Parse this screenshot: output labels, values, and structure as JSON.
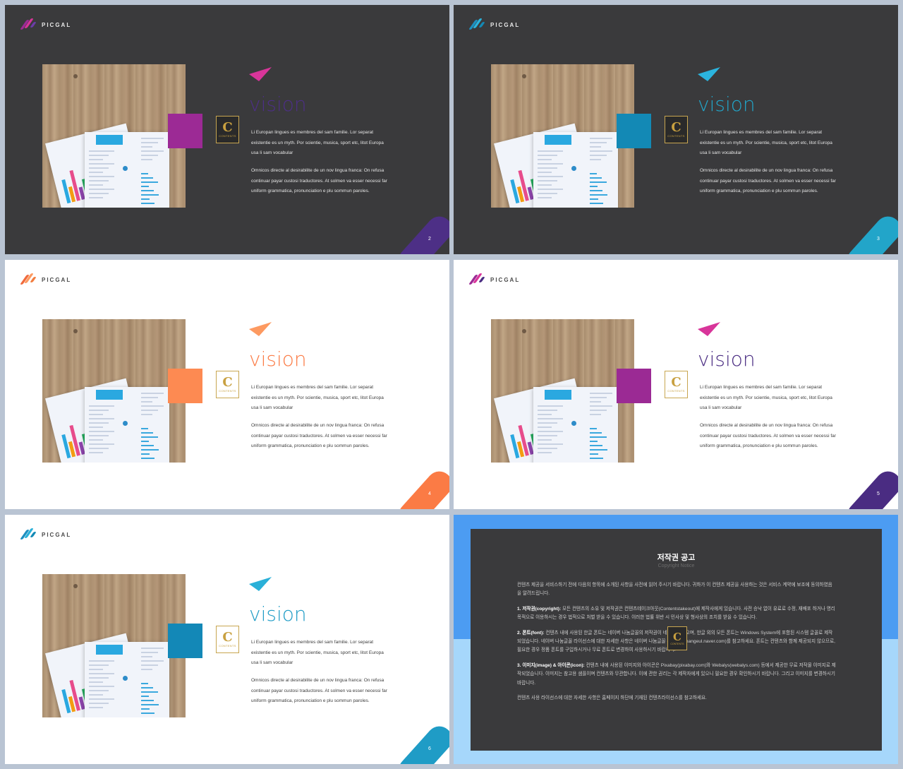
{
  "brand": {
    "name": "PICGAL"
  },
  "vision_slides": [
    {
      "theme": "dark",
      "accent": "#4d2f86",
      "swatch": "#9c2a95",
      "plane": "#d8359a",
      "logo_colors": [
        "#9c2a95",
        "#d8359a",
        "#6c3ca8"
      ],
      "title": "vision",
      "page": "2",
      "paragraph1": "Li Europan lingues es membres del sam familie. Lor separat existentie es un myth. Por scientie, musica, sport etc, litot Europa usa li sam vocabular",
      "paragraph2": "Omnicos directe al desirabilite de un nov lingua franca: On refusa continuar payar custosi traductores. At solmen va esser necessi far uniform grammatica, pronunciation e plu sommun paroles.",
      "badge": {
        "letter": "C",
        "text": "CONTENTS"
      }
    },
    {
      "theme": "dark",
      "accent": "#22a5c9",
      "swatch": "#1389b5",
      "plane": "#2bb4de",
      "logo_colors": [
        "#1e8fc0",
        "#2bb4de",
        "#1389b5"
      ],
      "title": "vision",
      "page": "3",
      "paragraph1": "Li Europan lingues es membres del sam familie. Lor separat existentie es un myth. Por scientie, musica, sport etc, litot Europa usa li sam vocabular",
      "paragraph2": "Omnicos directe al desirabilite de un nov lingua franca: On refusa continuar payar custosi traductores. At solmen va esser necessi far uniform grammatica, pronunciation e plu sommun paroles.",
      "badge": {
        "letter": "C",
        "text": "CONTENTS"
      }
    },
    {
      "theme": "light",
      "accent": "#fb7b45",
      "swatch": "#fd8a52",
      "plane": "#fd9a61",
      "logo_colors": [
        "#f06a3c",
        "#fd9a61",
        "#f27c3e"
      ],
      "title": "vision",
      "page": "4",
      "paragraph1": "Li Europan lingues es membres del sam familie. Lor separat existentie es un myth. Por scientie, musica, sport etc, litot Europa usa li sam vocabular",
      "paragraph2": "Omnicos directe al desirabilite de un nov lingua franca: On refusa continuar payar custosi traductores. At solmen va esser necessi far uniform grammatica, pronunciation e plu sommun paroles.",
      "badge": {
        "letter": "C",
        "text": "CONTENTS"
      }
    },
    {
      "theme": "light",
      "accent": "#4a2c82",
      "swatch": "#9b2a94",
      "plane": "#d8359a",
      "logo_colors": [
        "#9c2a95",
        "#d8359a",
        "#4a2c82"
      ],
      "title": "vision",
      "page": "5",
      "paragraph1": "Li Europan lingues es membres del sam familie. Lor separat existentie es un myth. Por scientie, musica, sport etc, litot Europa usa li sam vocabular",
      "paragraph2": "Omnicos directe al desirabilite de un nov lingua franca: On refusa continuar payar custosi traductores. At solmen va esser necessi far uniform grammatica, pronunciation e plu sommun paroles.",
      "badge": {
        "letter": "C",
        "text": "CONTENTS"
      }
    },
    {
      "theme": "light",
      "accent": "#1f9cc6",
      "swatch": "#1388b7",
      "plane": "#2ab0d8",
      "logo_colors": [
        "#1e8fc0",
        "#2ab0d8",
        "#1389b5"
      ],
      "title": "vision",
      "page": "6",
      "paragraph1": "Li Europan lingues es membres del sam familie. Lor separat existentie es un myth. Por scientie, musica, sport etc, litot Europa usa li sam vocabular",
      "paragraph2": "Omnicos directe al desirabilite de un nov lingua franca: On refusa continuar payar custosi traductores. At solmen va esser necessi far uniform grammatica, pronunciation e plu sommun paroles.",
      "badge": {
        "letter": "C",
        "text": "CONTENTS"
      }
    }
  ],
  "copyright": {
    "title": "저작권 공고",
    "subtitle": "Copyright Notice",
    "intro": "컨텐츠 제공을 서비스하기 전에 다음의 항목에 소개된 사항을 사전에 읽어 주시기 바랍니다. 귀하가 이 컨텐츠 제공을 사용하는 것은 서비스 계약에 보조에 동의하였음을 알려드립니다.",
    "item1_head": "1. 저작권(copyright):",
    "item1_body": " 모든 컨텐츠의 소유 및 저작권은 컨텐츠테이크아웃(Contentstakeout)에 제작사에게 있습니다. 사전 승낙 없이 유료로 수정, 재배포 하거나 영리 목적으로 이용하시는 경우 법적으로 처벌 받을 수 있습니다. 이러한 법률 위반 시 민사상 및 형사상의 조치를 받을 수 있습니다.",
    "item2_head": "2. 폰트(font):",
    "item2_body": " 컨텐츠 내에 사용된 한글 폰트는 네이버 나눔글꼴의 저작권이 네이버에 있으며, 한글 외의 모든 폰트는 Windows System에 포함된 시스템 글꼴로 제작되었습니다. 네이버 나눔글꼴 라이선스에 대한 자세한 사항은 네이버 나눔글꼴 홈페이지(hangeul.naver.com)를 참고하세요. 폰트는 컨텐츠와 함께 제공되지 않으므로, 필요한 경우 정품 폰트를 구입하시거나 무료 폰트로 변경하여 사용하시기 바랍니다.",
    "item3_head": "3. 이미지(image) & 아이콘(icon):",
    "item3_body": " 컨텐츠 내에 사용된 이미지와 아이콘은 Pixabay(pixabay.com)와 Webalys(webalys.com) 등에서 제공한 무료 저작물 이미지로 제작되었습니다. 이미지는 참고용 샘플이며 컨텐츠와 무관합니다. 이에 관한 권리는 각 제작자에게 있으니 필요한 경우 확인하시기 바랍니다. 그리고 이미지를 변경하시기 바랍니다.",
    "footer": "컨텐츠 사용 라이선스에 대한 자세한 사항은 홈페이지 하단에 기재된 컨텐츠라이선스를 참고하세요.",
    "colors": {
      "top": "#4c9cf2",
      "bottom": "#a6d7fb",
      "card": "#3a3a3c"
    },
    "badge": {
      "letter": "C",
      "text": "CONTENTS"
    }
  }
}
